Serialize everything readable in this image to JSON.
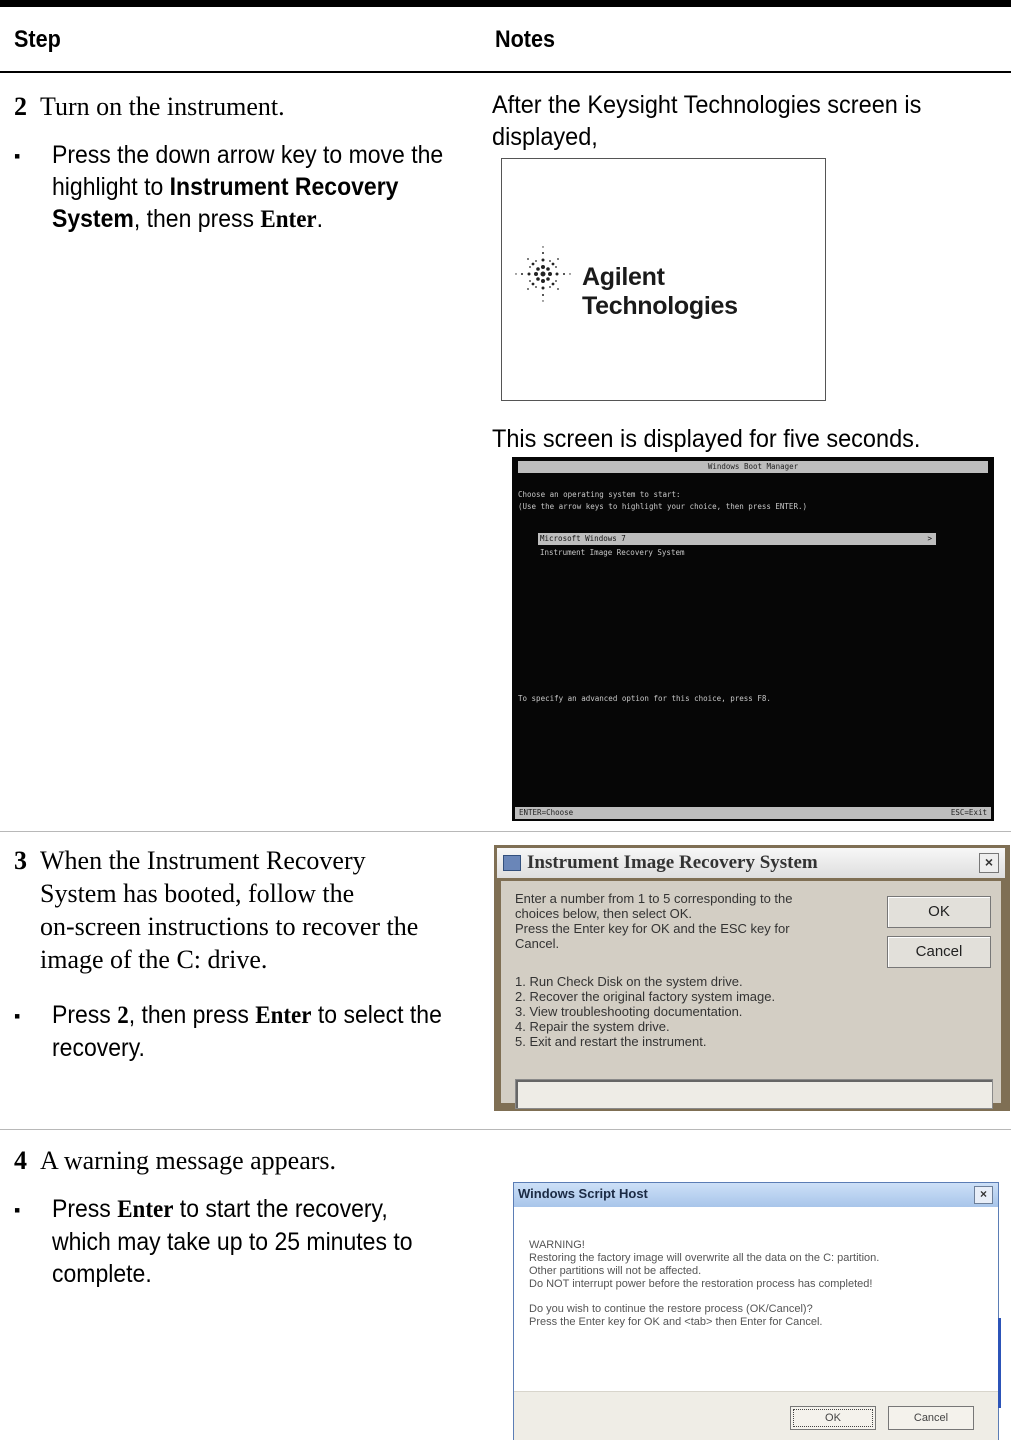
{
  "header": {
    "step_label": "Step",
    "notes_label": "Notes"
  },
  "steps": [
    {
      "number": "2",
      "text": "Turn on the instrument.",
      "sub": {
        "p1": "Press the down arrow key to move the highlight to ",
        "b1": "Instrument Recovery System",
        "p2": ", then press ",
        "b2": "Enter",
        "p3": "."
      },
      "notes": {
        "line1": "After the Keysight Technologies screen is displayed,",
        "line2": "This screen is displayed for five seconds."
      }
    },
    {
      "number": "3",
      "text_lines": [
        "When the Instrument Recovery",
        "System has booted, follow the",
        "on-screen instructions to recover the",
        "image of the C: drive."
      ],
      "sub": {
        "p1": "Press ",
        "b1": "2",
        "p2": ", then press ",
        "b2": "Enter",
        "p3": " to select the recovery."
      }
    },
    {
      "number": "4",
      "text": "A warning message appears.",
      "sub": {
        "p1": "Press ",
        "b1": "Enter",
        "p2": " to start the recovery, which may take up to 25 minutes to complete."
      }
    }
  ],
  "splash": {
    "brand": "Agilent Technologies"
  },
  "boot_manager": {
    "title": "Windows Boot Manager",
    "line1": "Choose an operating system to start:",
    "line2": "(Use the arrow keys to highlight your choice, then press ENTER.)",
    "options": [
      "Microsoft Windows 7",
      "Instrument Image Recovery System"
    ],
    "arrow": ">",
    "advanced": "To specify an advanced option for this choice, press F8.",
    "footer_left": "ENTER=Choose",
    "footer_right": "ESC=Exit"
  },
  "iirs_dialog": {
    "title": "Instrument Image Recovery System",
    "close": "×",
    "intro": [
      "Enter a number from 1 to 5 corresponding to the",
      "choices below, then select OK.",
      "Press the Enter key for OK and the ESC key for",
      "Cancel."
    ],
    "choices": [
      "1. Run Check Disk on the system drive.",
      "2. Recover the original factory system image.",
      "3. View troubleshooting documentation.",
      "4. Repair the system drive.",
      "5. Exit and restart the instrument."
    ],
    "ok": "OK",
    "cancel": "Cancel",
    "input_value": ""
  },
  "wsh_dialog": {
    "title": "Windows Script Host",
    "close": "×",
    "lines": [
      "WARNING!",
      "Restoring the factory image will overwrite all the data on the C: partition.",
      "Other partitions will not be affected.",
      "Do NOT interrupt power before the restoration process has completed!",
      "",
      "Do you wish to continue the restore process (OK/Cancel)?",
      "Press the Enter key for OK and <tab> then Enter for Cancel."
    ],
    "ok": "OK",
    "cancel": "Cancel"
  },
  "colors": {
    "boot_bg": "#060606",
    "iirs_frame": "#7f6f54",
    "wsh_title": "#a8c5ea"
  }
}
